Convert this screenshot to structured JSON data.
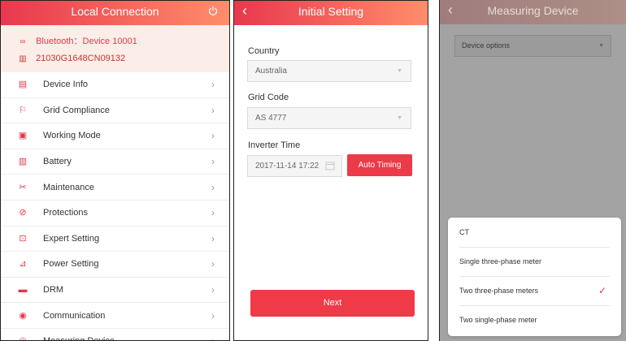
{
  "panel1": {
    "title": "Local Connection",
    "bluetooth": "Bluetooth：Device 10001",
    "serial": "21030G1648CN09132",
    "menu": [
      {
        "label": "Device Info",
        "icon": "device-info-icon",
        "glyph": "▤"
      },
      {
        "label": "Grid Compliance",
        "icon": "grid-tower-icon",
        "glyph": "⚐"
      },
      {
        "label": "Working Mode",
        "icon": "working-mode-icon",
        "glyph": "▣"
      },
      {
        "label": "Battery",
        "icon": "battery-icon",
        "glyph": "▥"
      },
      {
        "label": "Maintenance",
        "icon": "tools-icon",
        "glyph": "✂"
      },
      {
        "label": "Protections",
        "icon": "protection-icon",
        "glyph": "⊘"
      },
      {
        "label": "Expert Setting",
        "icon": "expert-setting-icon",
        "glyph": "⊡"
      },
      {
        "label": "Power Setting",
        "icon": "power-setting-icon",
        "glyph": "⊿"
      },
      {
        "label": "DRM",
        "icon": "drm-icon",
        "glyph": "▬"
      },
      {
        "label": "Communication",
        "icon": "communication-icon",
        "glyph": "◉"
      },
      {
        "label": "Measuring Device",
        "icon": "measuring-device-icon",
        "glyph": "◎"
      }
    ]
  },
  "panel2": {
    "title": "Initial Setting",
    "country_label": "Country",
    "country_value": "Australia",
    "grid_label": "Grid Code",
    "grid_value": "AS 4777",
    "time_label": "Inverter Time",
    "time_value": "2017-11-14  17:22",
    "auto_button": "Auto Timing",
    "next_button": "Next"
  },
  "panel3": {
    "title": "Measuring Device",
    "select_placeholder": "Device options",
    "options": [
      {
        "label": "CT",
        "selected": false
      },
      {
        "label": "Single three-phase meter",
        "selected": false
      },
      {
        "label": "Two three-phase meters",
        "selected": true
      },
      {
        "label": "Two single-phase meter",
        "selected": false
      }
    ]
  },
  "colors": {
    "accent": "#ec3a48",
    "header_gradient_start": "#e8384e",
    "header_gradient_end": "#ff8d6b"
  }
}
